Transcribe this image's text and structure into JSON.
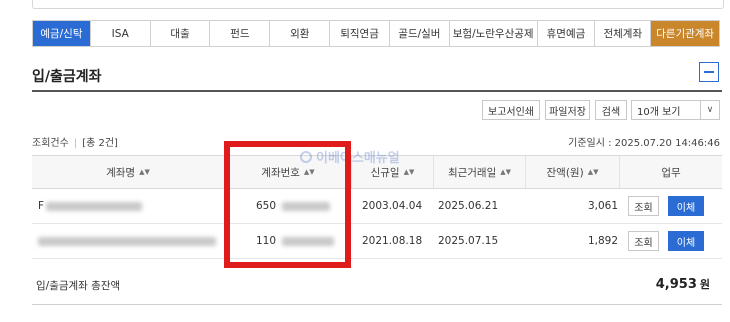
{
  "tabs": [
    {
      "label": "예금/신탁",
      "state": "active"
    },
    {
      "label": "ISA",
      "state": ""
    },
    {
      "label": "대출",
      "state": ""
    },
    {
      "label": "펀드",
      "state": ""
    },
    {
      "label": "외환",
      "state": ""
    },
    {
      "label": "퇴직연금",
      "state": ""
    },
    {
      "label": "골드/실버",
      "state": ""
    },
    {
      "label": "보험/노란우산공제",
      "state": ""
    },
    {
      "label": "휴면예금",
      "state": ""
    },
    {
      "label": "전체계좌",
      "state": ""
    },
    {
      "label": "다른기관계좌",
      "state": "other"
    }
  ],
  "section": {
    "title": "입/출금계좌"
  },
  "toolbar": {
    "report_print": "보고서인쇄",
    "save_file": "파일저장",
    "search": "검색",
    "page_size": "10개 보기"
  },
  "meta": {
    "count_label": "조회건수",
    "count_value": "[총 2건]",
    "base_time": "기준일시 : 2025.07.20 14:46:46"
  },
  "table": {
    "headers": [
      "계좌명",
      "계좌번호",
      "신규일",
      "최근거래일",
      "잔액(원)",
      "업무"
    ],
    "rows": [
      {
        "account_name": "F",
        "account_prefix": "650",
        "opened": "2003.04.04",
        "last_tx": "2025.06.21",
        "balance": "3,061",
        "view": "조회",
        "transfer": "이체"
      },
      {
        "account_name": "",
        "account_prefix": "110",
        "opened": "2021.08.18",
        "last_tx": "2025.07.15",
        "balance": "1,892",
        "view": "조회",
        "transfer": "이체"
      }
    ]
  },
  "total": {
    "label": "입/출금계좌 총잔액",
    "amount": "4,953",
    "unit": "원"
  },
  "watermark": "이베이스매뉴얼",
  "colors": {
    "accent": "#2b6cd4",
    "other_tab": "#c9862a",
    "highlight": "#e01b1b"
  }
}
